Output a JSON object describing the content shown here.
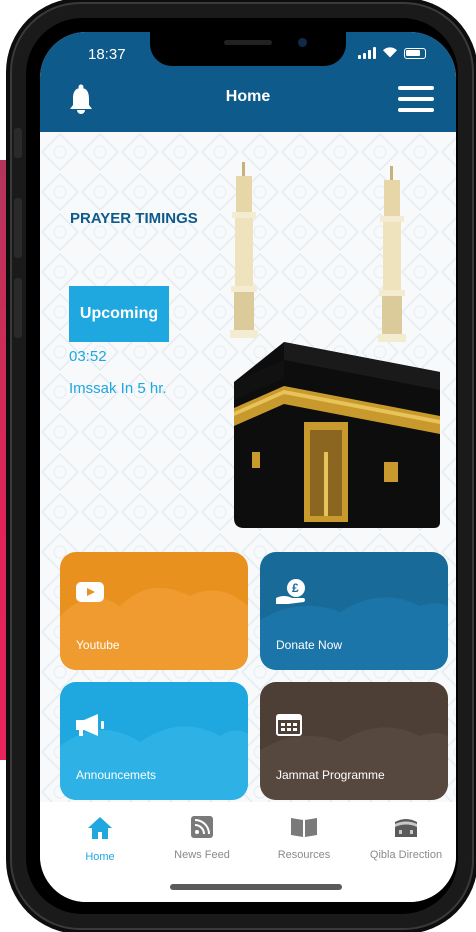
{
  "status": {
    "time": "18:37"
  },
  "header": {
    "title": "Home"
  },
  "prayer": {
    "section_title": "PRAYER TIMINGS",
    "upcoming_label": "Upcoming",
    "time": "03:52",
    "next_label": "Imssak In 5 hr."
  },
  "tiles": [
    {
      "label": "Youtube",
      "color": "#e8911f",
      "icon": "youtube-icon"
    },
    {
      "label": "Donate Now",
      "color": "#186a99",
      "icon": "donate-icon"
    },
    {
      "label": "Announcemets",
      "color": "#1fa8df",
      "icon": "megaphone-icon"
    },
    {
      "label": "Jammat Programme",
      "color": "#4d3f35",
      "icon": "calendar-icon"
    }
  ],
  "nav": [
    {
      "label": "Home",
      "icon": "home-icon",
      "active": true
    },
    {
      "label": "News Feed",
      "icon": "rss-icon"
    },
    {
      "label": "Resources",
      "icon": "book-icon"
    },
    {
      "label": "Qibla Direction",
      "icon": "kaaba-icon"
    }
  ],
  "colors": {
    "brand": "#0e5a8a",
    "accent": "#1fa8df",
    "nav_inactive": "#8a8a8a"
  }
}
